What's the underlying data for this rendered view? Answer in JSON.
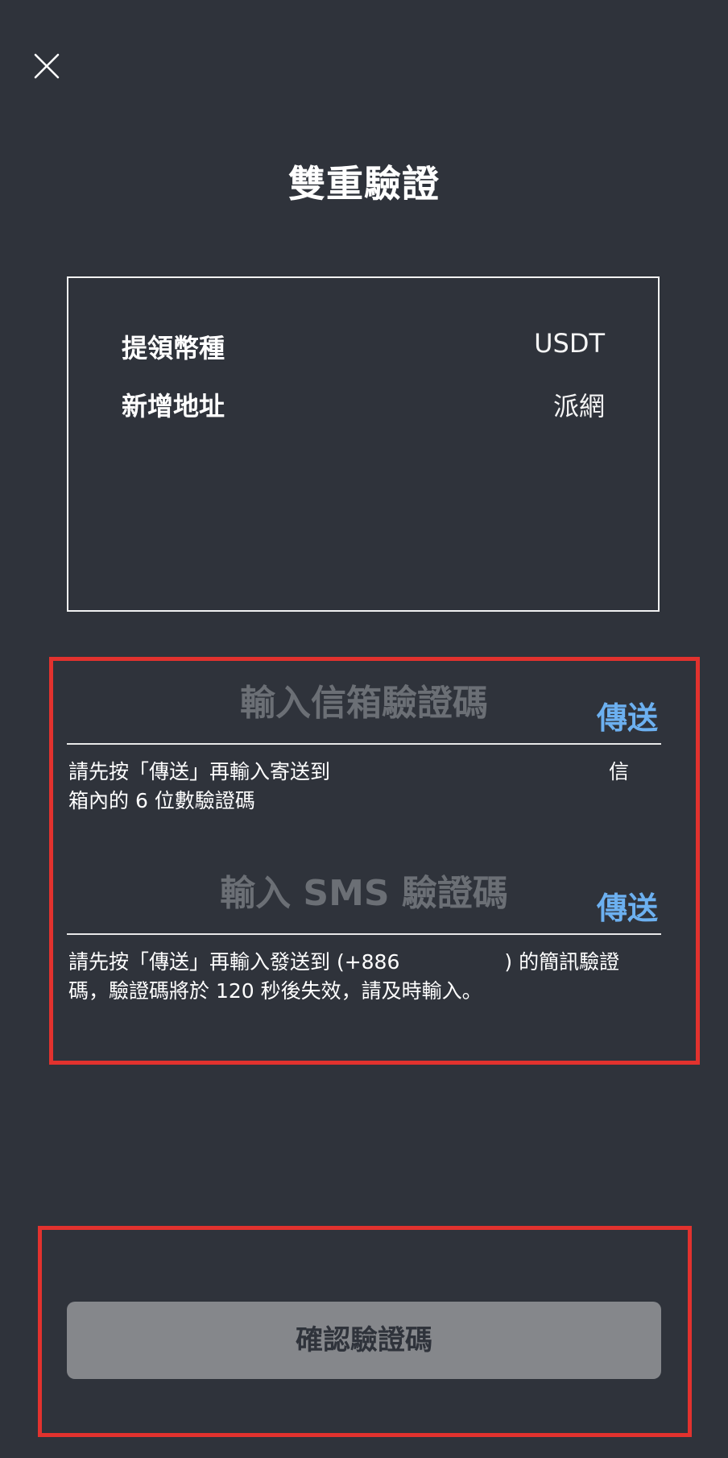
{
  "header": {
    "close_icon": "close-icon",
    "title": "雙重驗證"
  },
  "summary": {
    "rows": [
      {
        "label": "提領幣種",
        "value": "USDT"
      },
      {
        "label": "新增地址",
        "value": "派網"
      }
    ]
  },
  "email_verification": {
    "placeholder": "輸入信箱驗證碼",
    "value": "",
    "send_label": "傳送",
    "hint_part1": "請先按「傳送」再輸入寄送到",
    "hint_part2": "信",
    "hint_part3": "箱內的 6 位數驗證碼"
  },
  "sms_verification": {
    "placeholder": "輸入 SMS 驗證碼",
    "value": "",
    "send_label": "傳送",
    "hint_part1": "請先按「傳送」再輸入發送到 (+886",
    "hint_part2": ") 的簡訊驗證",
    "hint_part3": "碼，驗證碼將於 120 秒後失效，請及時輸入。"
  },
  "confirm_button": {
    "label": "確認驗證碼"
  },
  "colors": {
    "background": "#2f333b",
    "accent_link": "#6cb0f0",
    "highlight_border": "#e2322e",
    "button_disabled": "#85878b"
  }
}
